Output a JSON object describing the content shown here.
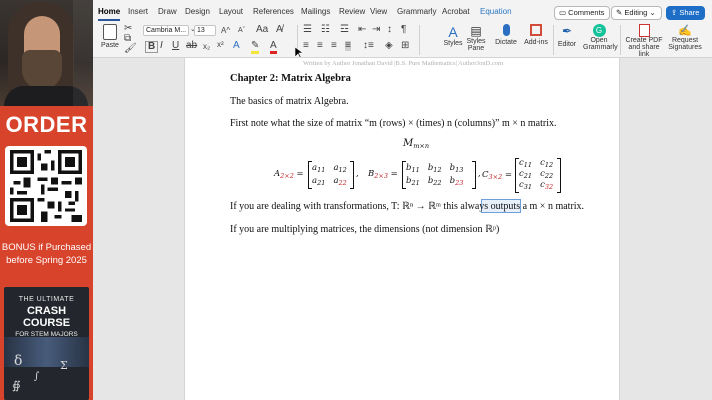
{
  "promo": {
    "order": "ORDER",
    "bonus_line1": "BONUS if Purchased",
    "bonus_line2": "before Spring 2025",
    "book_line1": "THE ULTIMATE",
    "book_line2": "CRASH COURSE",
    "book_line3": "FOR STEM MAJORS"
  },
  "tabs": [
    "Home",
    "Insert",
    "Draw",
    "Design",
    "Layout",
    "References",
    "Mailings",
    "Review",
    "View",
    "Grammarly",
    "Acrobat",
    "Equation"
  ],
  "active_tab": "Home",
  "top_buttons": {
    "comments": "Comments",
    "editing": "Editing",
    "share": "Share"
  },
  "ribbon": {
    "paste": "Paste",
    "font_name": "Cambria M...",
    "font_size": "13",
    "styles": "Styles",
    "styles_pane_1": "Styles",
    "styles_pane_2": "Pane",
    "dictate": "Dictate",
    "addins": "Add-ins",
    "editor": "Editor",
    "open_grammarly_1": "Open",
    "open_grammarly_2": "Grammarly",
    "create_pdf_1": "Create PDF",
    "create_pdf_2": "and share link",
    "request_sig_1": "Request",
    "request_sig_2": "Signatures"
  },
  "document": {
    "header": "Written by Author Jonathan David |B.S. Pure Mathematics| AuthorJonD.com",
    "chapter": "Chapter 2: Matrix Algebra",
    "basics": "The basics of matrix Algebra.",
    "first_note": "First note what the size of matrix “m (rows) ×  (times)  n (columns)” m × n matrix.",
    "mmn": "M",
    "mmn_sub": "m×n",
    "matrix_a_label": "A",
    "matrix_a_sub": "2×2",
    "matrix_b_label": "B",
    "matrix_b_sub": "2×3",
    "matrix_c_label": "C",
    "matrix_c_sub": "3×2",
    "transform_line": "If you are dealing with transformations, T: ℝⁿ → ℝᵐ this always outputs a  m × n  matrix.",
    "multiply_line": "If you are multiplying matrices, the dimensions (not dimension ℝᵖ)"
  },
  "colors": {
    "promo_bg": "#d8432c",
    "accent": "#2b579a",
    "share": "#1e6ec8",
    "subscript_red": "#c0282b"
  }
}
